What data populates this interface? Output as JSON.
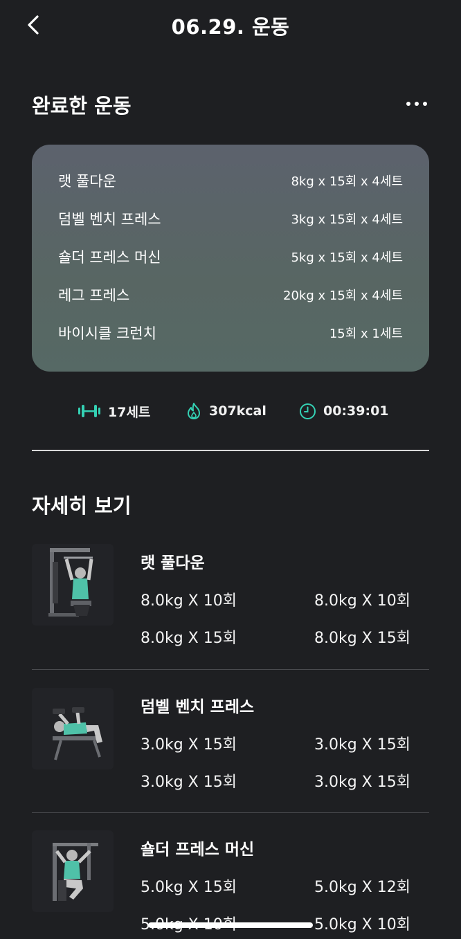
{
  "header": {
    "title": "06.29. 운동",
    "back_icon": "chevron-left-icon"
  },
  "completed": {
    "title": "완료한 운동",
    "more_icon": "more-horizontal-icon",
    "rows": [
      {
        "name": "랫 풀다운",
        "detail": "8kg x 15회 x 4세트"
      },
      {
        "name": "덤벨 벤치 프레스",
        "detail": "3kg x 15회 x 4세트"
      },
      {
        "name": "숄더 프레스 머신",
        "detail": "5kg x 15회 x 4세트"
      },
      {
        "name": "레그 프레스",
        "detail": "20kg x 15회 x 4세트"
      },
      {
        "name": "바이시클 크런치",
        "detail": "15회 x 1세트"
      }
    ]
  },
  "stats": {
    "sets": "17세트",
    "calories": "307kcal",
    "duration": "00:39:01",
    "accent": "#34d1b4"
  },
  "detail": {
    "title": "자세히 보기",
    "exercises": [
      {
        "name": "랫 풀다운",
        "sets": [
          "8.0kg X 10회",
          "8.0kg X 10회",
          "8.0kg X 15회",
          "8.0kg X 15회"
        ]
      },
      {
        "name": "덤벨 벤치 프레스",
        "sets": [
          "3.0kg X 15회",
          "3.0kg X 15회",
          "3.0kg X 15회",
          "3.0kg X 15회"
        ]
      },
      {
        "name": "숄더 프레스 머신",
        "sets": [
          "5.0kg X 15회",
          "5.0kg X 12회",
          "5.0kg X 10회",
          "5.0kg X 10회"
        ]
      }
    ]
  }
}
